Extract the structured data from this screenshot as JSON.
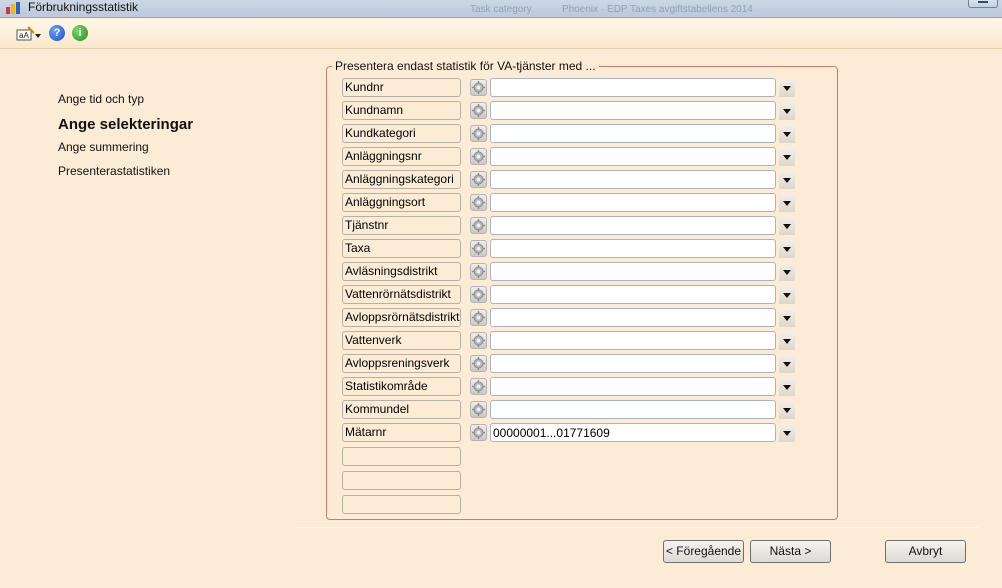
{
  "window": {
    "title": "Förbrukningsstatistik",
    "background_text_1": "Task category",
    "background_text_2": "Phoenix · EDP Taxes avgiftstabellens 2014"
  },
  "toolbar": {
    "font_icon": "font-settings-icon",
    "help_icon": "help-icon",
    "help_glyph": "?",
    "info_icon": "info-icon",
    "info_glyph": "i"
  },
  "nav": {
    "items": [
      {
        "label": "Ange tid och typ",
        "active": false
      },
      {
        "label": "Ange selekteringar",
        "active": true
      },
      {
        "label": "Ange summering",
        "active": false
      },
      {
        "label": "Presenterastatistiken",
        "active": false
      }
    ]
  },
  "group": {
    "legend": "Presentera endast statistik för VA-tjänster med ..."
  },
  "filters": [
    {
      "label": "Kundnr",
      "value": ""
    },
    {
      "label": "Kundnamn",
      "value": ""
    },
    {
      "label": "Kundkategori",
      "value": ""
    },
    {
      "label": "Anläggningsnr",
      "value": ""
    },
    {
      "label": "Anläggningskategori",
      "value": ""
    },
    {
      "label": "Anläggningsort",
      "value": ""
    },
    {
      "label": "Tjänstnr",
      "value": ""
    },
    {
      "label": "Taxa",
      "value": ""
    },
    {
      "label": "Avläsningsdistrikt",
      "value": ""
    },
    {
      "label": "Vattenrörnätsdistrikt",
      "value": ""
    },
    {
      "label": "Avloppsrörnätsdistrikt",
      "value": ""
    },
    {
      "label": "Vattenverk",
      "value": ""
    },
    {
      "label": "Avloppsreningsverk",
      "value": ""
    },
    {
      "label": "Statistikområde",
      "value": ""
    },
    {
      "label": "Kommundel",
      "value": ""
    },
    {
      "label": "Mätarnr",
      "value": "00000001...01771609"
    }
  ],
  "buttons": {
    "previous": "< Föregående",
    "next": "Nästa >",
    "cancel": "Avbryt"
  },
  "colors": {
    "background": "#fcecd6",
    "group_border": "#c77b73"
  }
}
